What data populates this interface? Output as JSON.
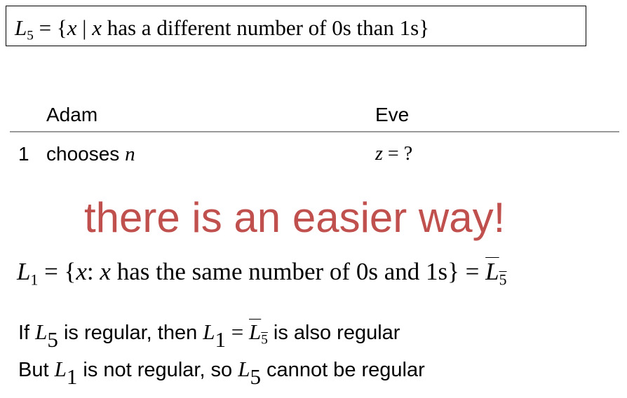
{
  "definition": {
    "lhs_symbol": "L",
    "lhs_sub": "5",
    "eq": " = {",
    "var1": "x",
    "bar": " | ",
    "var2": "x",
    "desc": " has a different number of 0s than 1s}"
  },
  "table": {
    "headers": {
      "adam": "Adam",
      "eve": "Eve"
    },
    "rows": [
      {
        "num": "1",
        "adam_text": "chooses ",
        "adam_var": "n",
        "eve_var": "z",
        "eve_rest": " = ?"
      }
    ]
  },
  "callout": "there is an easier way!",
  "l1_line": {
    "sym": "L",
    "sub": "1",
    "eq": " = {",
    "var1": "x",
    "colon": ": ",
    "var2": "x",
    "desc": " has the same number of 0s and 1s} = ",
    "comp_sym": "L",
    "comp_sub": "5"
  },
  "statements": [
    {
      "p1": "If ",
      "s1": "L",
      "s1sub": "5",
      "p2": " is regular, then ",
      "s2": "L",
      "s2sub": "1",
      "eq": " = ",
      "s3": "L",
      "s3sub": "5",
      "p3": " is also regular"
    },
    {
      "p1": "But ",
      "s1": "L",
      "s1sub": "1",
      "p2": " is not regular, so ",
      "s2": "L",
      "s2sub": "5",
      "p3": " cannot be regular"
    }
  ]
}
